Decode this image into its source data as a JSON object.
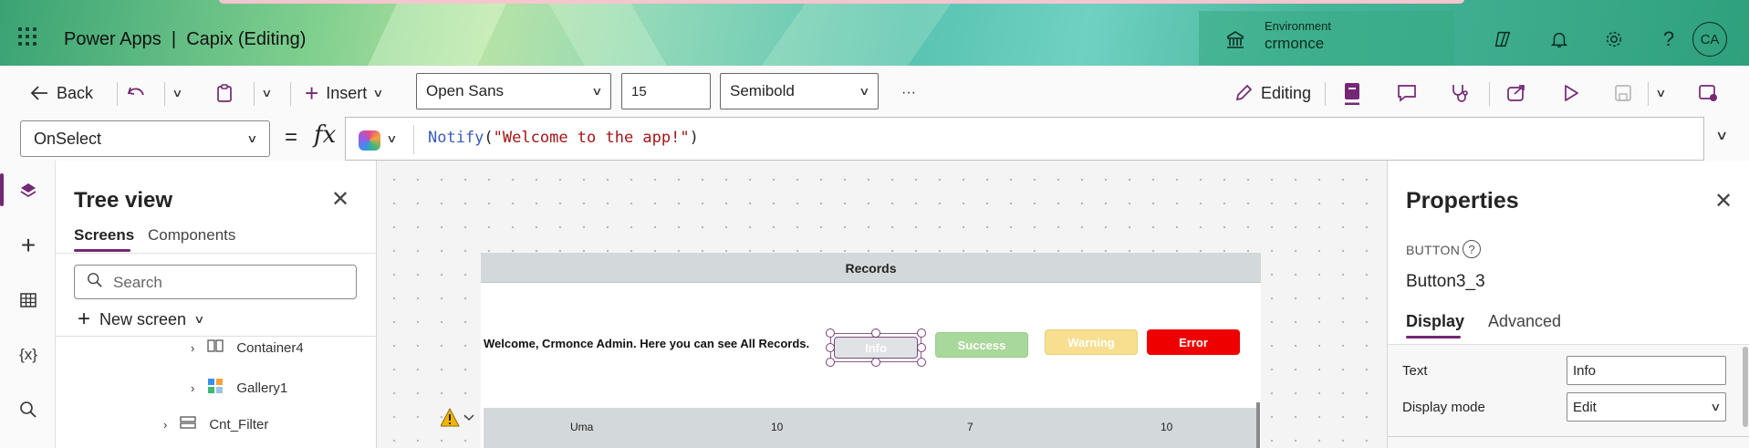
{
  "header": {
    "app_name": "Power Apps",
    "separator": "|",
    "app_title": "Capix (Editing)",
    "environment_label": "Environment",
    "environment_value": "crmonce",
    "avatar_initials": "CA"
  },
  "toolbar": {
    "back_label": "Back",
    "insert_label": "Insert",
    "font_family": "Open Sans",
    "font_size": "15",
    "font_weight": "Semibold",
    "more_label": "···",
    "editing_label": "Editing"
  },
  "formula": {
    "property": "OnSelect",
    "eq": "=",
    "fx": "fx",
    "fn_name": "Notify",
    "open_paren": "(",
    "string_arg": "\"Welcome to the app!\"",
    "close_paren": ")"
  },
  "tree_view": {
    "title": "Tree view",
    "tabs": [
      "Screens",
      "Components"
    ],
    "search_placeholder": "Search",
    "new_screen_label": "New screen",
    "items": [
      "Container4",
      "Gallery1",
      "Cnt_Filter"
    ]
  },
  "canvas": {
    "screen_header": "Records",
    "welcome_text": "Welcome, Crmonce Admin. Here you can see All Records.",
    "buttons": [
      {
        "label": "Info",
        "color": "#dfe3e6"
      },
      {
        "label": "Success",
        "color": "#a8d89a"
      },
      {
        "label": "Warning",
        "color": "#f7df8f"
      },
      {
        "label": "Error",
        "color": "#ee0000"
      }
    ],
    "gallery_row": [
      "Uma",
      "10",
      "7",
      "10"
    ]
  },
  "properties": {
    "title": "Properties",
    "control_type": "BUTTON",
    "control_name": "Button3_3",
    "tabs": [
      "Display",
      "Advanced"
    ],
    "fields": [
      {
        "label": "Text",
        "value": "Info"
      },
      {
        "label": "Display mode",
        "value": "Edit"
      }
    ]
  },
  "colors": {
    "accent": "#742774"
  }
}
